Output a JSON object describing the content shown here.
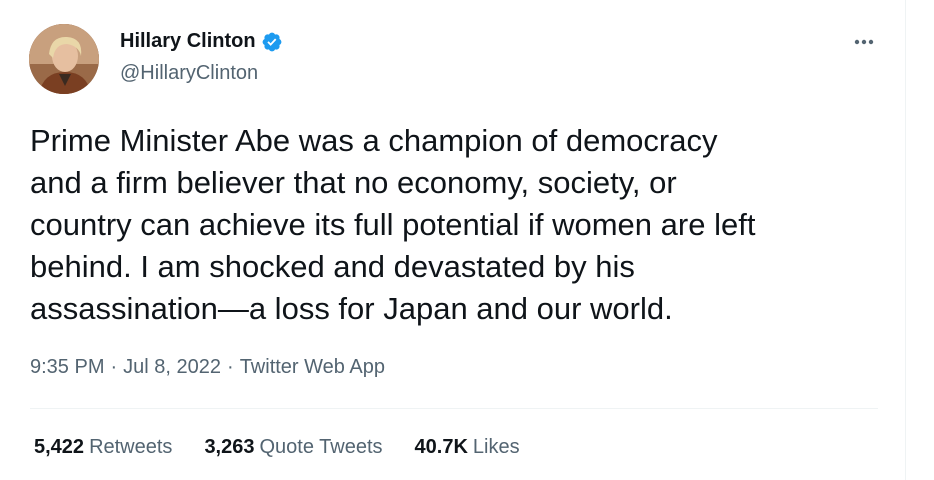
{
  "author": {
    "name": "Hillary Clinton",
    "handle": "@HillaryClinton",
    "verified_icon": "verified-badge-icon"
  },
  "tweet": {
    "text": "Prime Minister Abe was a champion of democracy\nand a firm believer that no economy, society, or\ncountry can achieve its full potential if women are left\nbehind. I am shocked and devastated by his\nassassination—a loss for Japan and our world."
  },
  "meta": {
    "time": "9:35 PM",
    "separator": "·",
    "date": "Jul 8, 2022",
    "source": "Twitter Web App"
  },
  "stats": {
    "retweets": {
      "count": "5,422",
      "label": "Retweets"
    },
    "quotes": {
      "count": "3,263",
      "label": "Quote Tweets"
    },
    "likes": {
      "count": "40.7K",
      "label": "Likes"
    }
  },
  "colors": {
    "text": "#0f1419",
    "secondary": "#536471",
    "verified": "#1d9bf0",
    "divider": "#eff3f4"
  }
}
